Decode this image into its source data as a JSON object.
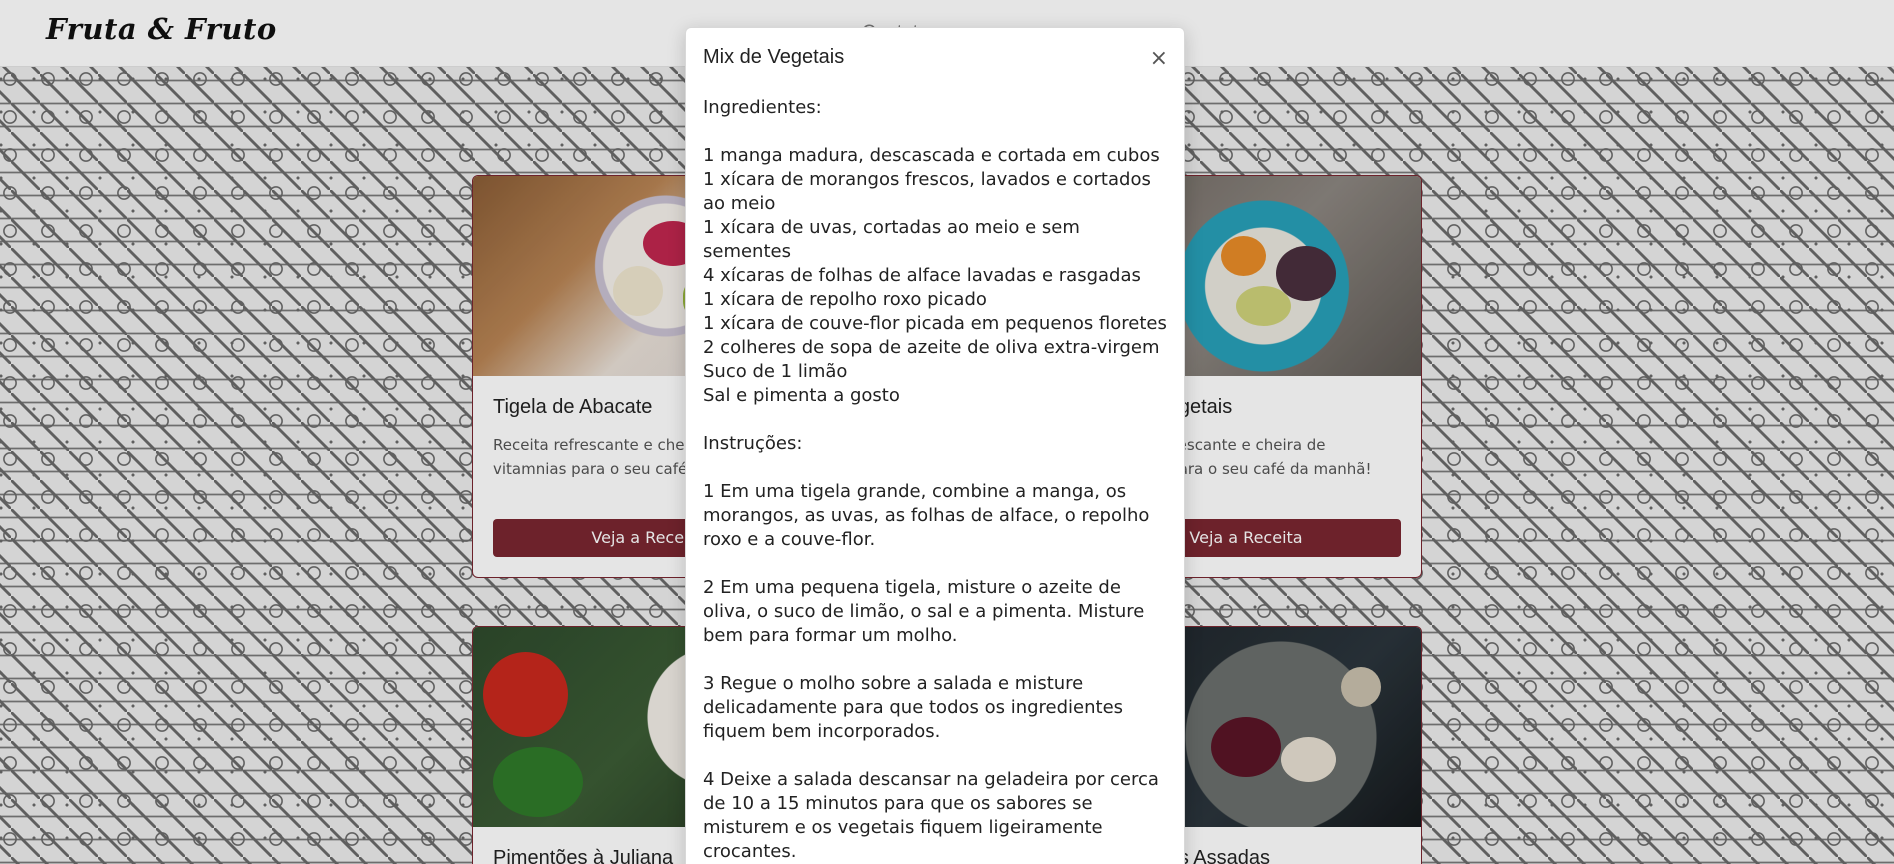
{
  "navbar": {
    "brand": "Fruta & Fruto",
    "links": [
      "Contatos"
    ]
  },
  "cards": [
    {
      "title": "Tigela de Abacate",
      "text": "Receita refrescante e cheira de vitamnias para o seu café da manhã!",
      "button": "Veja a Receita"
    },
    {
      "title": "Mix de Vegetais",
      "text": "Receita refrescante e cheira de vitamnias para o seu café da manhã!",
      "button": "Veja a Receita"
    },
    {
      "title": "Pimentões à Juliana"
    },
    {
      "title": "Beterrabas Assadas"
    }
  ],
  "modal": {
    "title": "Mix de Vegetais",
    "close_label": "×",
    "ingredients_heading": "Ingredientes:",
    "ingredients": [
      "1 manga madura, descascada e cortada em cubos",
      "1 xícara de morangos frescos, lavados e cortados ao meio",
      "1 xícara de uvas, cortadas ao meio e sem sementes",
      "4 xícaras de folhas de alface lavadas e rasgadas",
      "1 xícara de repolho roxo picado",
      "1 xícara de couve-flor picada em pequenos floretes",
      "2 colheres de sopa de azeite de oliva extra-virgem",
      "Suco de 1 limão",
      "Sal e pimenta a gosto"
    ],
    "instructions_heading": "Instruções:",
    "instructions": [
      "1 Em uma tigela grande, combine a manga, os morangos, as uvas, as folhas de alface, o repolho roxo e a couve-flor.",
      "2 Em uma pequena tigela, misture o azeite de oliva, o suco de limão, o sal e a pimenta. Misture bem para formar um molho.",
      "3 Regue o molho sobre a salada e misture delicadamente para que todos os ingredientes fiquem bem incorporados.",
      "4 Deixe a salada descansar na geladeira por cerca de 10 a 15 minutos para que os sabores se misturem e os vegetais fiquem ligeiramente crocantes."
    ]
  },
  "colors": {
    "accent": "#7a2630",
    "nav_link": "#7d7d7d"
  }
}
